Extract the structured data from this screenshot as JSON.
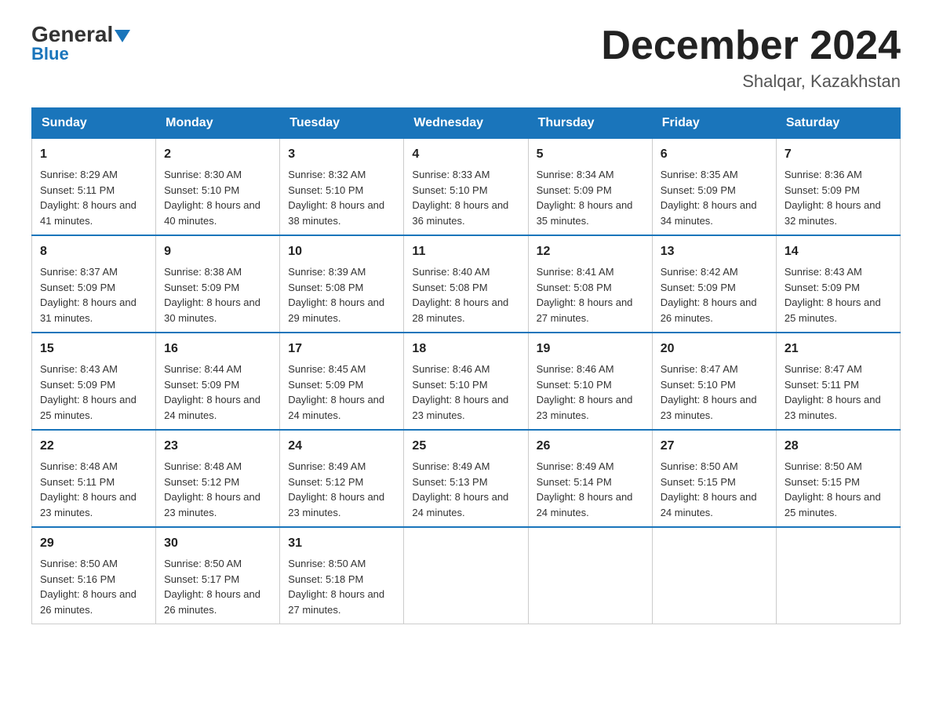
{
  "header": {
    "logo_general": "General",
    "logo_blue": "Blue",
    "month_title": "December 2024",
    "location": "Shalqar, Kazakhstan"
  },
  "days_of_week": [
    "Sunday",
    "Monday",
    "Tuesday",
    "Wednesday",
    "Thursday",
    "Friday",
    "Saturday"
  ],
  "weeks": [
    [
      {
        "day": "1",
        "sunrise": "8:29 AM",
        "sunset": "5:11 PM",
        "daylight": "8 hours and 41 minutes."
      },
      {
        "day": "2",
        "sunrise": "8:30 AM",
        "sunset": "5:10 PM",
        "daylight": "8 hours and 40 minutes."
      },
      {
        "day": "3",
        "sunrise": "8:32 AM",
        "sunset": "5:10 PM",
        "daylight": "8 hours and 38 minutes."
      },
      {
        "day": "4",
        "sunrise": "8:33 AM",
        "sunset": "5:10 PM",
        "daylight": "8 hours and 36 minutes."
      },
      {
        "day": "5",
        "sunrise": "8:34 AM",
        "sunset": "5:09 PM",
        "daylight": "8 hours and 35 minutes."
      },
      {
        "day": "6",
        "sunrise": "8:35 AM",
        "sunset": "5:09 PM",
        "daylight": "8 hours and 34 minutes."
      },
      {
        "day": "7",
        "sunrise": "8:36 AM",
        "sunset": "5:09 PM",
        "daylight": "8 hours and 32 minutes."
      }
    ],
    [
      {
        "day": "8",
        "sunrise": "8:37 AM",
        "sunset": "5:09 PM",
        "daylight": "8 hours and 31 minutes."
      },
      {
        "day": "9",
        "sunrise": "8:38 AM",
        "sunset": "5:09 PM",
        "daylight": "8 hours and 30 minutes."
      },
      {
        "day": "10",
        "sunrise": "8:39 AM",
        "sunset": "5:08 PM",
        "daylight": "8 hours and 29 minutes."
      },
      {
        "day": "11",
        "sunrise": "8:40 AM",
        "sunset": "5:08 PM",
        "daylight": "8 hours and 28 minutes."
      },
      {
        "day": "12",
        "sunrise": "8:41 AM",
        "sunset": "5:08 PM",
        "daylight": "8 hours and 27 minutes."
      },
      {
        "day": "13",
        "sunrise": "8:42 AM",
        "sunset": "5:09 PM",
        "daylight": "8 hours and 26 minutes."
      },
      {
        "day": "14",
        "sunrise": "8:43 AM",
        "sunset": "5:09 PM",
        "daylight": "8 hours and 25 minutes."
      }
    ],
    [
      {
        "day": "15",
        "sunrise": "8:43 AM",
        "sunset": "5:09 PM",
        "daylight": "8 hours and 25 minutes."
      },
      {
        "day": "16",
        "sunrise": "8:44 AM",
        "sunset": "5:09 PM",
        "daylight": "8 hours and 24 minutes."
      },
      {
        "day": "17",
        "sunrise": "8:45 AM",
        "sunset": "5:09 PM",
        "daylight": "8 hours and 24 minutes."
      },
      {
        "day": "18",
        "sunrise": "8:46 AM",
        "sunset": "5:10 PM",
        "daylight": "8 hours and 23 minutes."
      },
      {
        "day": "19",
        "sunrise": "8:46 AM",
        "sunset": "5:10 PM",
        "daylight": "8 hours and 23 minutes."
      },
      {
        "day": "20",
        "sunrise": "8:47 AM",
        "sunset": "5:10 PM",
        "daylight": "8 hours and 23 minutes."
      },
      {
        "day": "21",
        "sunrise": "8:47 AM",
        "sunset": "5:11 PM",
        "daylight": "8 hours and 23 minutes."
      }
    ],
    [
      {
        "day": "22",
        "sunrise": "8:48 AM",
        "sunset": "5:11 PM",
        "daylight": "8 hours and 23 minutes."
      },
      {
        "day": "23",
        "sunrise": "8:48 AM",
        "sunset": "5:12 PM",
        "daylight": "8 hours and 23 minutes."
      },
      {
        "day": "24",
        "sunrise": "8:49 AM",
        "sunset": "5:12 PM",
        "daylight": "8 hours and 23 minutes."
      },
      {
        "day": "25",
        "sunrise": "8:49 AM",
        "sunset": "5:13 PM",
        "daylight": "8 hours and 24 minutes."
      },
      {
        "day": "26",
        "sunrise": "8:49 AM",
        "sunset": "5:14 PM",
        "daylight": "8 hours and 24 minutes."
      },
      {
        "day": "27",
        "sunrise": "8:50 AM",
        "sunset": "5:15 PM",
        "daylight": "8 hours and 24 minutes."
      },
      {
        "day": "28",
        "sunrise": "8:50 AM",
        "sunset": "5:15 PM",
        "daylight": "8 hours and 25 minutes."
      }
    ],
    [
      {
        "day": "29",
        "sunrise": "8:50 AM",
        "sunset": "5:16 PM",
        "daylight": "8 hours and 26 minutes."
      },
      {
        "day": "30",
        "sunrise": "8:50 AM",
        "sunset": "5:17 PM",
        "daylight": "8 hours and 26 minutes."
      },
      {
        "day": "31",
        "sunrise": "8:50 AM",
        "sunset": "5:18 PM",
        "daylight": "8 hours and 27 minutes."
      },
      null,
      null,
      null,
      null
    ]
  ]
}
